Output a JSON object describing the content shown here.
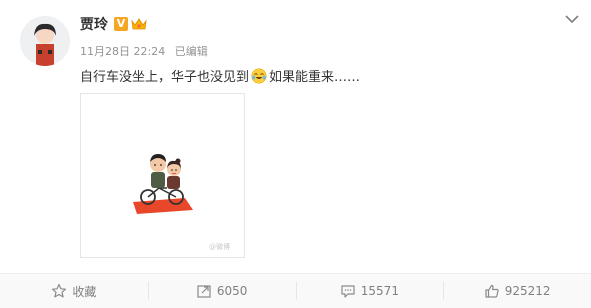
{
  "post": {
    "author_name": "贾玲",
    "verified_badge": "V",
    "timestamp": "11月28日 22:24",
    "edited_label": "已编辑",
    "text_before_emoji": "自行车没坐上，华子也没见到",
    "text_after_emoji": " 如果能重来……",
    "emoji": "laughing-with-tears-emoji",
    "image": {
      "description": "cartoon",
      "watermark": "@微博"
    }
  },
  "actions": {
    "favorite_label": "收藏",
    "repost_count": "6050",
    "comment_count": "15571",
    "like_count": "925212"
  },
  "colors": {
    "accent_orange": "#f5a623",
    "meta_gray": "#939393",
    "text": "#333333",
    "action_bar_bg": "#f9f9f9"
  }
}
